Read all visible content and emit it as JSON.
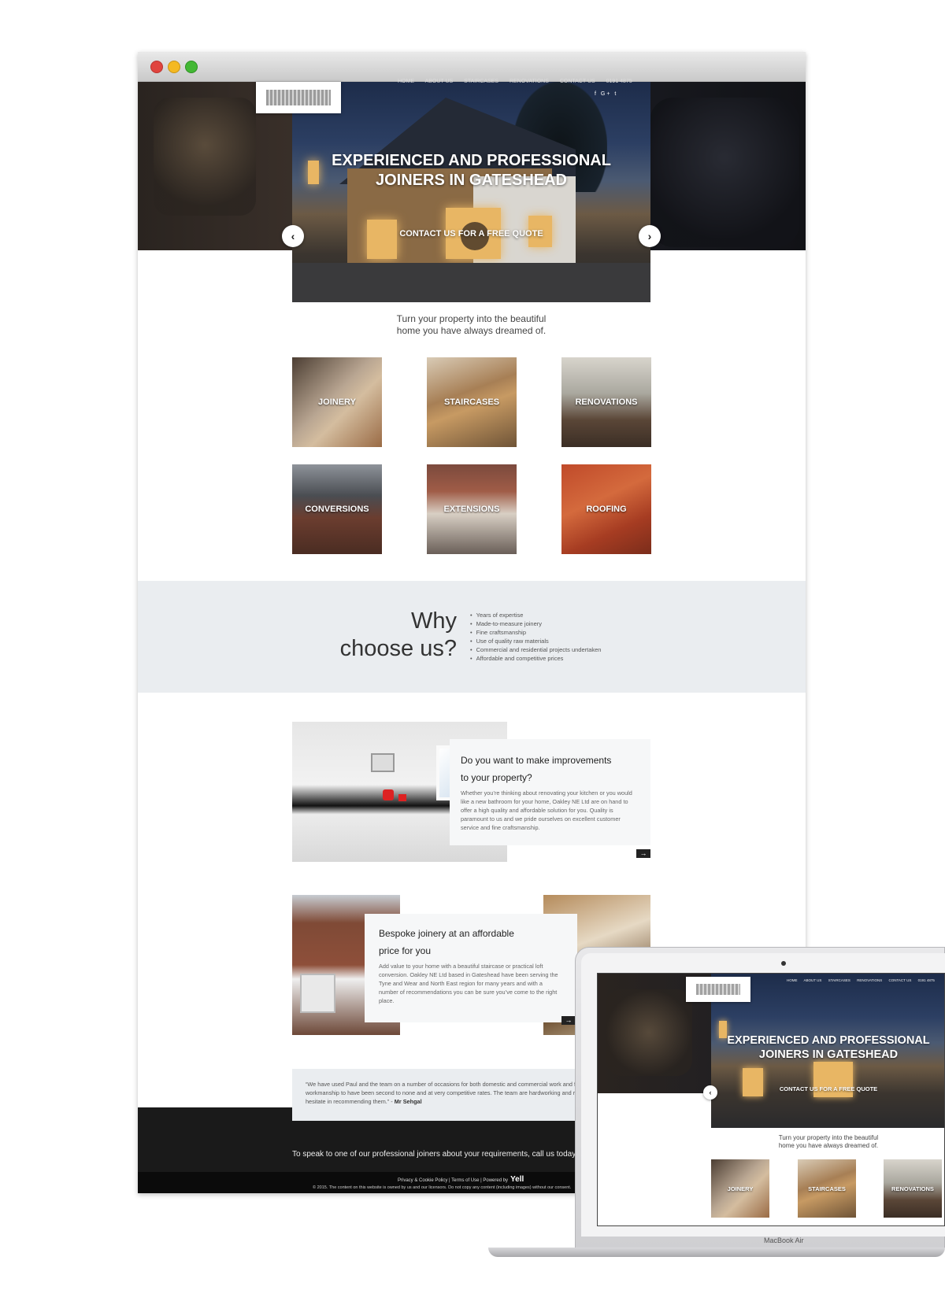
{
  "nav": {
    "items": [
      "HOME",
      "ABOUT US",
      "STAIRCASES",
      "RENOVATIONS",
      "CONTACT US"
    ],
    "phone": "0191 4875"
  },
  "hero": {
    "title_line1": "EXPERIENCED AND PROFESSIONAL",
    "title_line2": "JOINERS IN GATESHEAD",
    "cta": "CONTACT US FOR A FREE QUOTE",
    "prev_arrow": "‹",
    "next_arrow": "›"
  },
  "tagline": {
    "line1": "Turn your property into the beautiful",
    "line2": "home you have always dreamed of."
  },
  "services": [
    "JOINERY",
    "STAIRCASES",
    "RENOVATIONS",
    "CONVERSIONS",
    "EXTENSIONS",
    "ROOFING"
  ],
  "why": {
    "heading_line1": "Why",
    "heading_line2": "choose us?",
    "points": [
      "Years of expertise",
      "Made-to-measure joinery",
      "Fine craftsmanship",
      "Use of quality raw materials",
      "Commercial and residential projects undertaken",
      "Affordable and competitive prices"
    ]
  },
  "feature1": {
    "heading_line1": "Do you want to make improvements",
    "heading_line2": "to your property?",
    "body": "Whether you’re thinking about renovating your kitchen or you would like a new bathroom for your home, Oakley NE Ltd are on hand to offer a high quality and affordable solution for you. Quality is paramount to us and we pride ourselves on excellent customer service and fine craftsmanship."
  },
  "feature2": {
    "heading_line1": "Bespoke joinery at an affordable",
    "heading_line2": "price for you",
    "body": "Add value to your home with a beautiful staircase or practical loft conversion. Oakley NE Ltd based in Gateshead have been serving the Tyne and Wear and North East region for many years and with a number of recommendations you can be sure you’ve come to the right place."
  },
  "quote": {
    "text": "“We have used Paul and the team on a number of occasions for both domestic and commercial work and found the quality of workmanship to have been second to none and at very competitive rates. The team are hardworking and reliable and I would not hesitate in recommending them.” - ",
    "author": "Mr Sehgal"
  },
  "footer": {
    "cta": "To speak to one of our professional joiners about your requirements, call us today.",
    "links": "Privacy & Cookie Policy | Terms of Use | Powered by",
    "yell": "Yell",
    "copyright": "© 2015. The content on this website is owned by us and our licensors. Do not copy any content (including images) without our consent."
  },
  "laptop": {
    "model": "MacBook Air"
  },
  "icons": {
    "next": "→",
    "social": "f G+ t"
  }
}
